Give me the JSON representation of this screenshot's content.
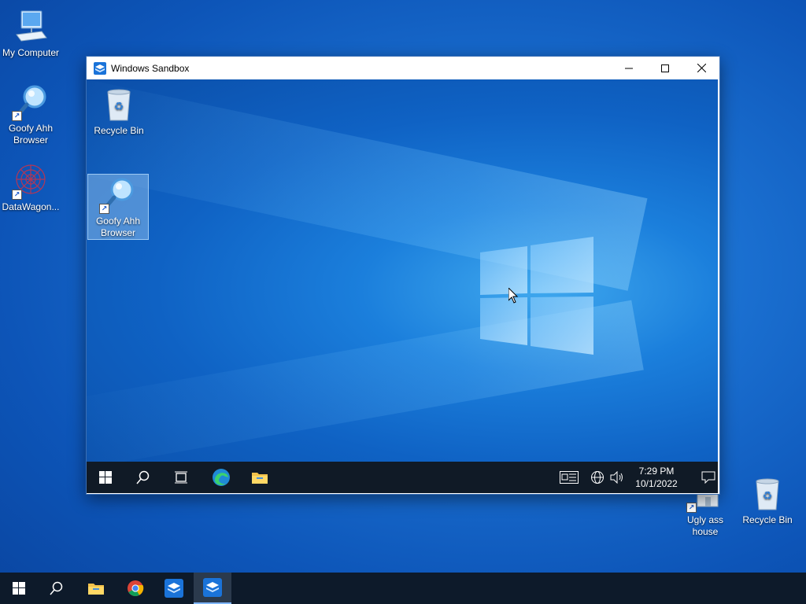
{
  "host_desktop": {
    "icons": [
      {
        "label": "My Computer"
      },
      {
        "label": "Goofy Ahh Browser"
      },
      {
        "label": "DataWagon..."
      },
      {
        "label": "Ugly ass house"
      },
      {
        "label": "Recycle Bin"
      }
    ]
  },
  "window": {
    "title": "Windows Sandbox",
    "controls": {
      "minimize": "minimize",
      "maximize": "maximize",
      "close": "close"
    }
  },
  "sandbox_desktop": {
    "icons": [
      {
        "label": "Recycle Bin"
      },
      {
        "label": "Goofy Ahh Browser"
      }
    ]
  },
  "sandbox_taskbar": {
    "time": "7:29 PM",
    "date": "10/1/2022"
  },
  "colors": {
    "accent": "#1a6fd0",
    "taskbar": "#101a26",
    "active_indicator": "#7fb6ff"
  },
  "icons": [
    "windows-start-icon",
    "search-icon",
    "task-view-icon",
    "edge-icon",
    "file-explorer-icon",
    "chrome-icon",
    "sandbox-icon",
    "news-icon",
    "network-icon",
    "volume-icon",
    "notification-icon",
    "recycle-bin-icon",
    "magnifier-icon",
    "computer-icon"
  ]
}
